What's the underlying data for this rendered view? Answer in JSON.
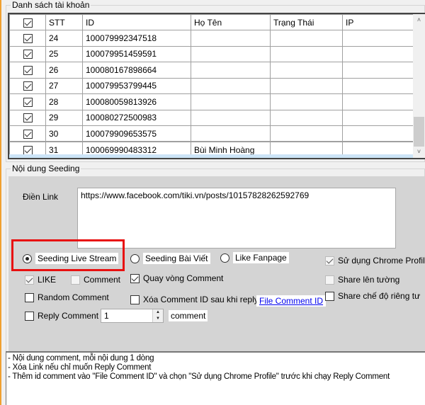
{
  "accounts": {
    "title": "Danh sách tài khoản",
    "columns": [
      "",
      "STT",
      "ID",
      "Họ Tên",
      "Trạng Thái",
      "IP"
    ],
    "header_checked": true,
    "rows": [
      {
        "checked": true,
        "stt": "24",
        "id": "100079992347518",
        "name": "",
        "status": "",
        "ip": ""
      },
      {
        "checked": true,
        "stt": "25",
        "id": "100079951459591",
        "name": "",
        "status": "",
        "ip": ""
      },
      {
        "checked": true,
        "stt": "26",
        "id": "100080167898664",
        "name": "",
        "status": "",
        "ip": ""
      },
      {
        "checked": true,
        "stt": "27",
        "id": "100079953799445",
        "name": "",
        "status": "",
        "ip": ""
      },
      {
        "checked": true,
        "stt": "28",
        "id": "100080059813926",
        "name": "",
        "status": "",
        "ip": ""
      },
      {
        "checked": true,
        "stt": "29",
        "id": "100080272500983",
        "name": "",
        "status": "",
        "ip": ""
      },
      {
        "checked": true,
        "stt": "30",
        "id": "100079909653575",
        "name": "",
        "status": "",
        "ip": ""
      },
      {
        "checked": true,
        "stt": "31",
        "id": "100069990483312",
        "name": "Bùi Minh Hoàng",
        "status": "",
        "ip": ""
      }
    ],
    "scrollbar": {
      "up_icon": "▲",
      "down_icon": "▼"
    }
  },
  "seeding": {
    "title": "Nội dung Seeding",
    "link_label": "Điền Link",
    "link_value": "https://www.facebook.com/tiki.vn/posts/10157828262592769",
    "modes": [
      {
        "label": "Seeding Live Stream",
        "selected": true
      },
      {
        "label": "Seeding Bài Viết",
        "selected": false
      },
      {
        "label": "Like Fanpage",
        "selected": false
      }
    ],
    "options": {
      "like": {
        "label": "LIKE",
        "checked": true
      },
      "comment": {
        "label": "Comment",
        "checked": false
      },
      "rotate_comment": {
        "label": "Quay vòng Comment",
        "checked": true
      },
      "random_comment": {
        "label": "Random Comment",
        "checked": false
      },
      "delete_comment_id": {
        "label": "Xóa Comment ID sau khi reply",
        "checked": false
      },
      "reply_comment": {
        "label": "Reply Comment",
        "checked": false
      },
      "use_chrome_profile": {
        "label": "Sử dụng Chrome Profile",
        "checked": true
      },
      "share_wall": {
        "label": "Share lên tường",
        "checked": false
      },
      "share_private": {
        "label": "Share chế độ riêng tư",
        "checked": false
      }
    },
    "reply_count": "1",
    "reply_unit": "comment",
    "file_comment_link": "File Comment  ID"
  },
  "notes": [
    "- Nội dung comment, mỗi nội dung 1 dòng",
    "- Xóa Link nếu chỉ muốn Reply Comment",
    "- Thêm id comment vào \"File Comment ID\" và chọn \"Sử dụng Chrome Profile\" trước khi chạy Reply Comment"
  ]
}
